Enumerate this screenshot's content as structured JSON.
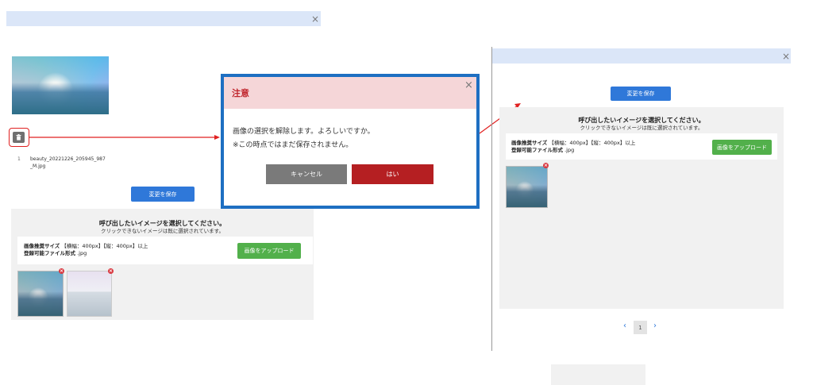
{
  "close_glyph": "×",
  "left": {
    "filename": "beauty_20221226_205945_987_M.jpg",
    "index": "1",
    "save_button": "変更を保存",
    "panel_title": "呼び出したいイメージを選択してください。",
    "panel_sub": "クリックできないイメージは既に選択されています。",
    "spec_line1_label": "画像推奨サイズ",
    "spec_line1_value": "【横幅：400px】【縦：400px】以上",
    "spec_line2_label": "登録可能ファイル形式",
    "spec_line2_value": ".jpg",
    "upload_button": "画像をアップロード",
    "remove_glyph": "×"
  },
  "dialog": {
    "title": "注意",
    "line1": "画像の選択を解除します。よろしいですか。",
    "line2": "※この時点ではまだ保存されません。",
    "cancel": "キャンセル",
    "ok": "はい"
  },
  "right": {
    "save_button": "変更を保存",
    "panel_title": "呼び出したいイメージを選択してください。",
    "panel_sub": "クリックできないイメージは既に選択されています。",
    "spec_line1_label": "画像推奨サイズ",
    "spec_line1_value": "【横幅：400px】【縦：400px】以上",
    "spec_line2_label": "登録可能ファイル形式",
    "spec_line2_value": ".jpg",
    "upload_button": "画像をアップロード",
    "remove_glyph": "×",
    "page_prev": "‹",
    "page_current": "1",
    "page_next": "›"
  },
  "colors": {
    "annotation_red": "#e02020",
    "dialog_border": "#1e6fc2",
    "dialog_header_bg": "#f5d6d8",
    "dialog_title": "#c0262d",
    "ok_button": "#b51f22",
    "cancel_button": "#7a7a7a"
  },
  "icons": {
    "delete": "trash-icon",
    "close": "close-icon"
  }
}
